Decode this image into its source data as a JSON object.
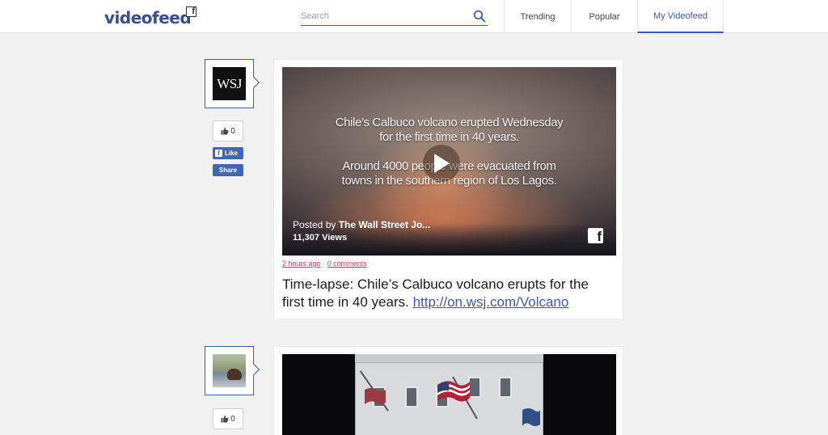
{
  "header": {
    "logo_text": "videofeed",
    "logo_badge": "f",
    "search_placeholder": "Search",
    "tabs": [
      {
        "label": "Trending",
        "active": false
      },
      {
        "label": "Popular",
        "active": false
      },
      {
        "label": "My Videofeed",
        "active": true
      }
    ],
    "accent_color": "#3f5aa6"
  },
  "posts": [
    {
      "source_logo_text": "WSJ",
      "likes": "0",
      "fb_like_label": "Like",
      "fb_share_label": "Share",
      "video_overlay_lines": [
        "Chile’s Calbuco volcano erupted Wednesday",
        "for the first time in 40 years.",
        "Around 4000 people were evacuated from",
        "towns in the southern region of Los Lagos."
      ],
      "posted_prefix": "Posted by",
      "posted_by": "The Wall Street Jo...",
      "views": "11,307 Views",
      "time_ago": "2 hours ago",
      "separator": "·",
      "comments": "0 comments",
      "caption_text": "Time-lapse: Chile’s Calbuco volcano erupts for the first time in 40 years. ",
      "caption_link": "http://on.wsj.com/Volcano"
    },
    {
      "likes": "0"
    }
  ]
}
